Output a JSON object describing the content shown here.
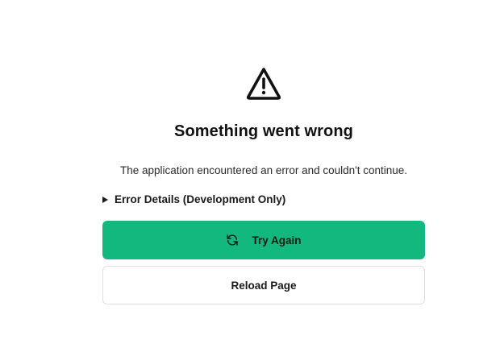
{
  "error": {
    "icon": "warning-triangle-icon",
    "title": "Something went wrong",
    "message": "The application encountered an error and couldn't continue.",
    "details_label": "Error Details (Development Only)"
  },
  "actions": {
    "retry_label": "Try Again",
    "retry_icon": "refresh-icon",
    "reload_label": "Reload Page"
  },
  "colors": {
    "primary": "#13b87f",
    "border": "#dcdfe3",
    "text": "#1f1f23"
  }
}
